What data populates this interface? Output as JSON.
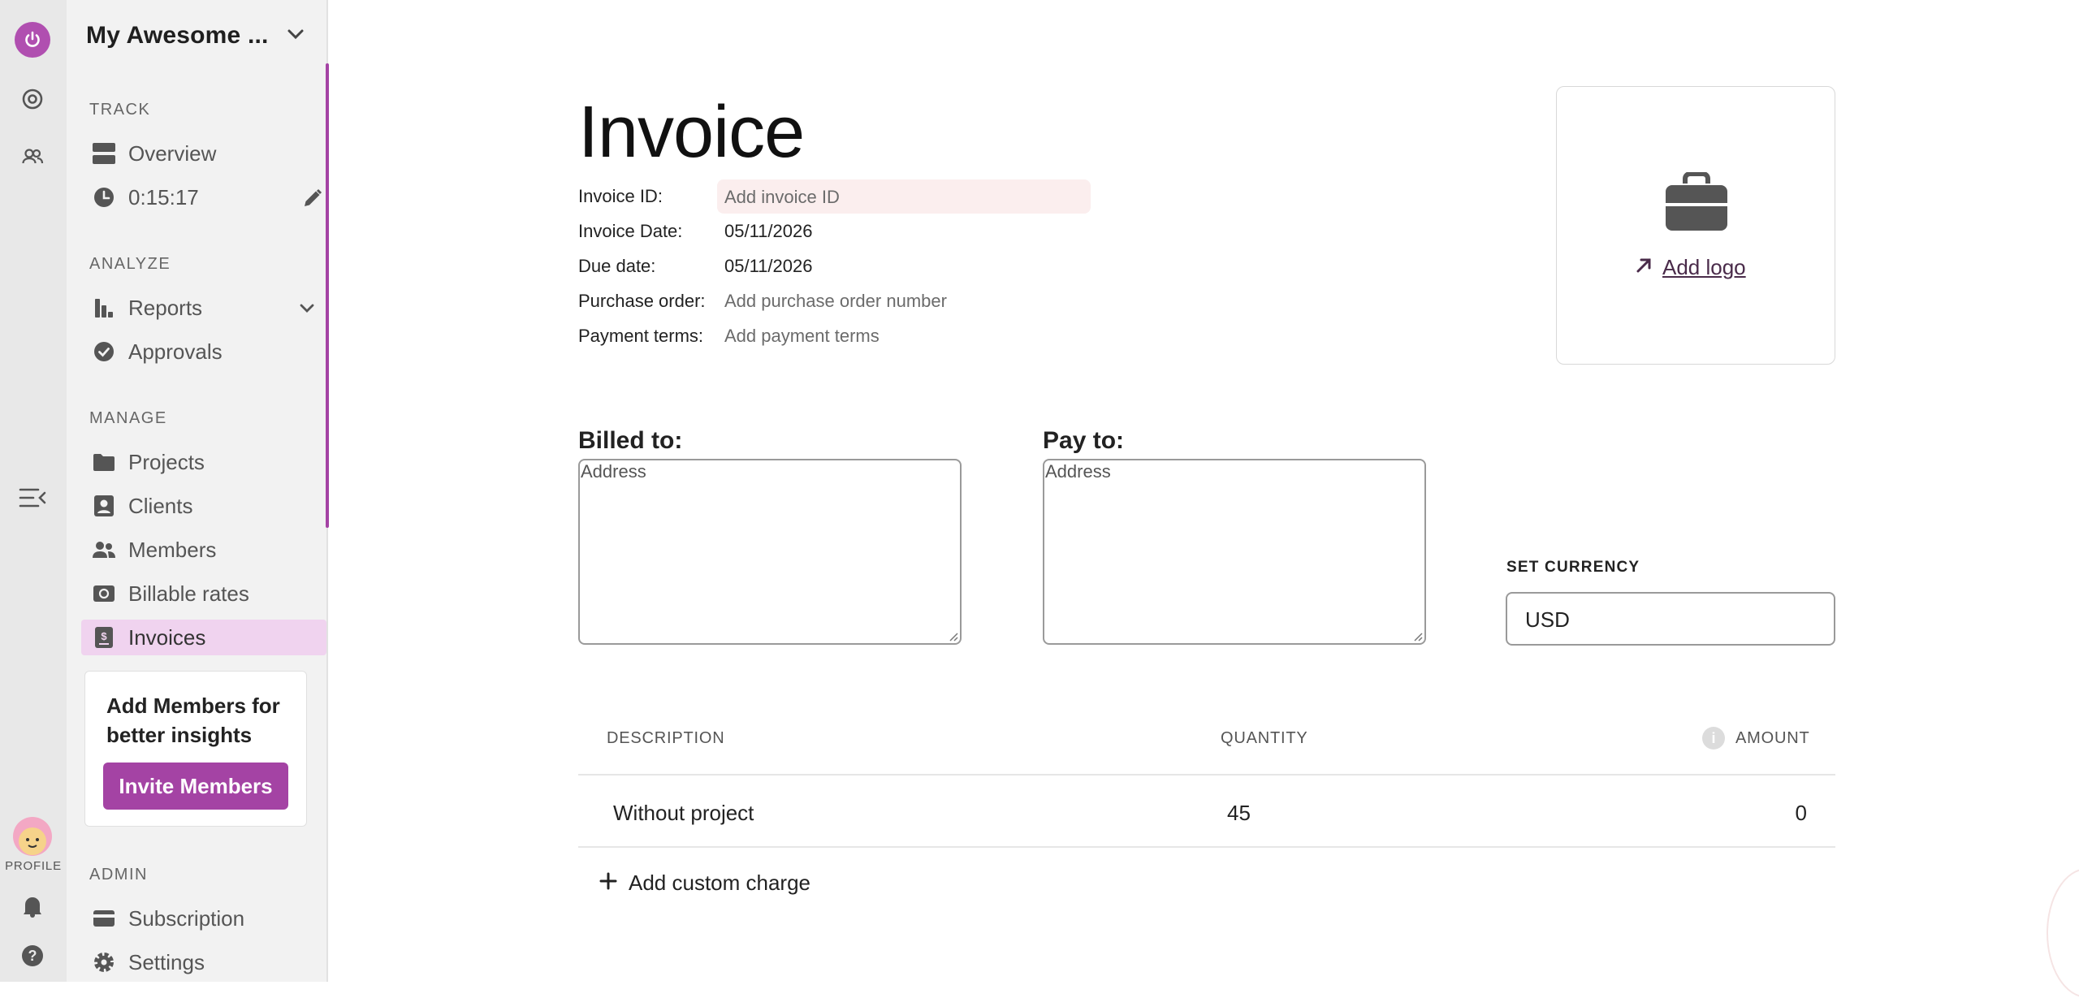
{
  "rail": {
    "profile_label": "PROFILE"
  },
  "sidebar": {
    "workspace_name": "My Awesome ...",
    "sections": {
      "track": "TRACK",
      "analyze": "ANALYZE",
      "manage": "MANAGE",
      "admin": "ADMIN"
    },
    "items": {
      "overview": "Overview",
      "timer": "0:15:17",
      "reports": "Reports",
      "approvals": "Approvals",
      "projects": "Projects",
      "clients": "Clients",
      "members": "Members",
      "billable_rates": "Billable rates",
      "invoices": "Invoices",
      "subscription": "Subscription",
      "settings": "Settings"
    },
    "active_item": "invoices",
    "promo": {
      "title": "Add Members for better insights",
      "button": "Invite Members"
    }
  },
  "invoice": {
    "title": "Invoice",
    "fields": {
      "id_label": "Invoice ID:",
      "id_placeholder": "Add invoice ID",
      "date_label": "Invoice Date:",
      "date_value": "05/11/2026",
      "due_label": "Due date:",
      "due_value": "05/11/2026",
      "po_label": "Purchase order:",
      "po_placeholder": "Add purchase order number",
      "terms_label": "Payment terms:",
      "terms_placeholder": "Add payment terms"
    },
    "logo": {
      "add_label": "Add logo"
    },
    "billed_to": {
      "label": "Billed to:",
      "placeholder": "Address"
    },
    "pay_to": {
      "label": "Pay to:",
      "placeholder": "Address"
    },
    "currency": {
      "label": "SET CURRENCY",
      "value": "USD"
    },
    "table": {
      "headers": {
        "description": "DESCRIPTION",
        "quantity": "QUANTITY",
        "amount": "AMOUNT"
      },
      "rows": [
        {
          "description": "Without project",
          "quantity": "45",
          "amount": "0"
        }
      ]
    },
    "add_charge": "Add custom charge"
  },
  "colors": {
    "accent": "#a443a4",
    "power": "#b04fb0",
    "active_nav_bg": "#f0d3ef",
    "invoice_id_bg": "#fbeeee"
  }
}
